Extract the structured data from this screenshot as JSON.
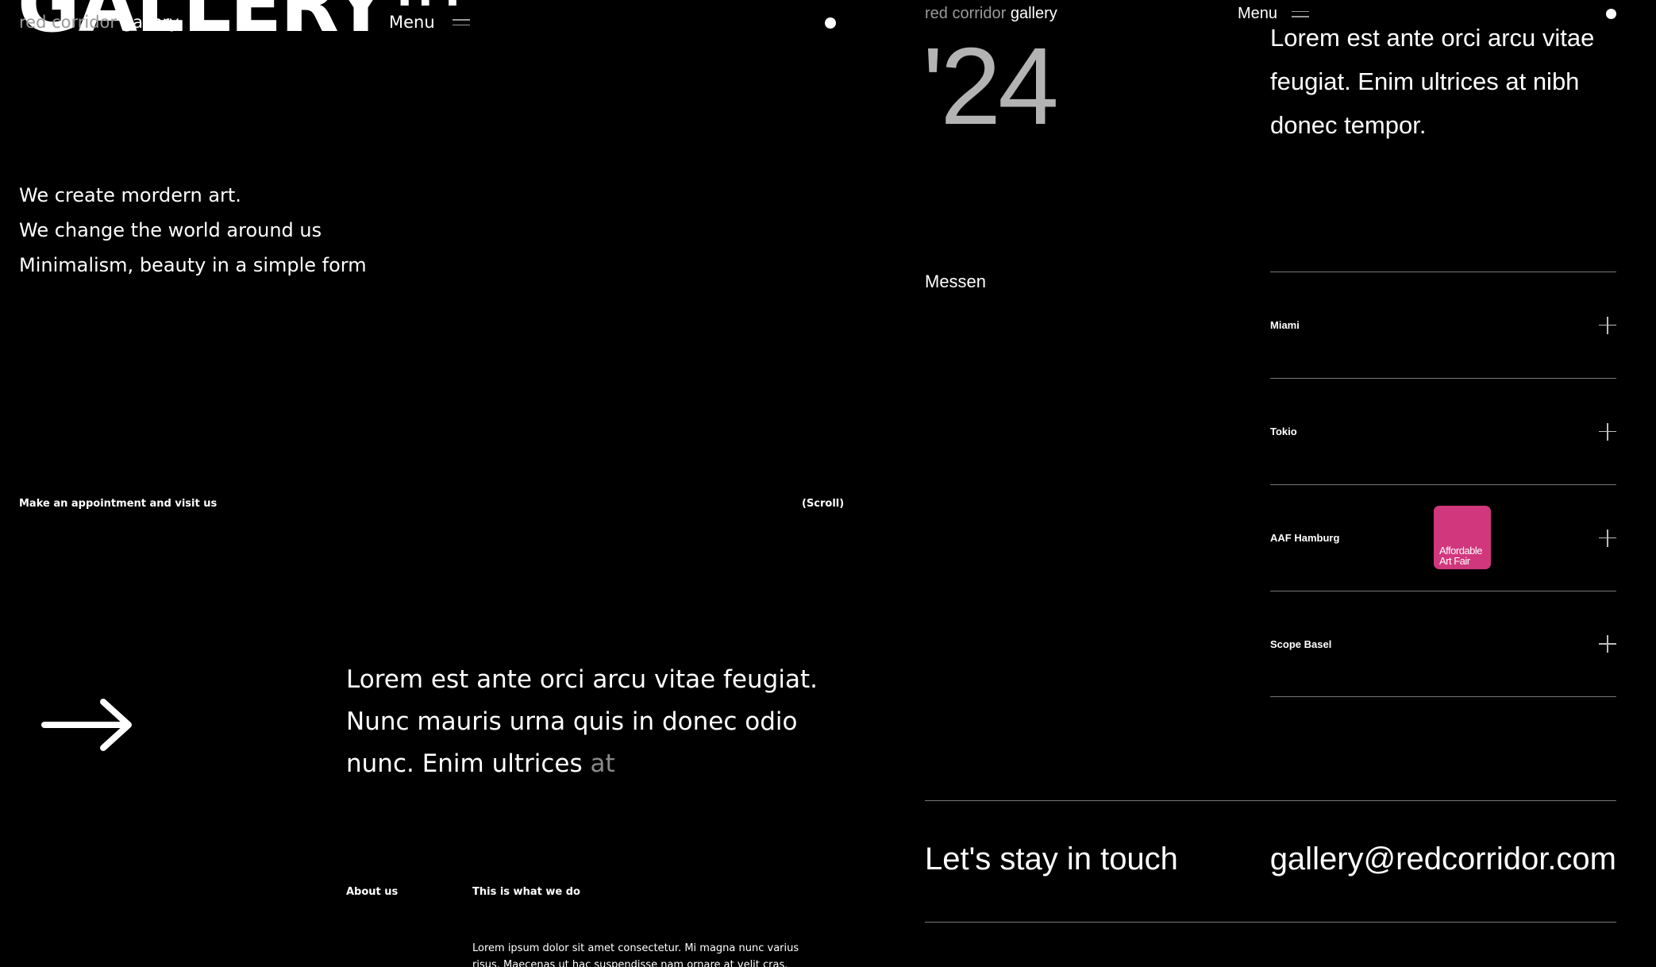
{
  "left": {
    "hero_title": "GALLERY",
    "hero_title_sup": "TM",
    "brand": {
      "muted": "red corridor",
      "main": "gallery"
    },
    "menu_label": "Menu",
    "intro_lines": [
      "We create mordern art.",
      "We change the world around us",
      "Minimalism, beauty in a simple form"
    ],
    "appointment": "Make an appointment and visit us",
    "scroll": "(Scroll)",
    "big_text_main": "Lorem est ante orci arcu vitae feugiat. Nunc mauris urna quis in donec odio nunc. Enim ultrices",
    "big_text_dim": "at",
    "about_label": "About us",
    "what_label": "This is what we do",
    "small_body": "Lorem ipsum dolor sit amet consectetur. Mi magna nunc varius risus. Maecenas ut hac suspendisse nam ornare at velit cras. Volutpat cursus."
  },
  "right": {
    "brand": {
      "muted": "red corridor",
      "main": "gallery"
    },
    "menu_label": "Menu",
    "year": "'24",
    "lorem": "Lorem est ante orci arcu vitae feugiat. Enim ultrices at nibh donec tempor.",
    "messen": "Messen",
    "fairs": [
      {
        "name": "Miami"
      },
      {
        "name": "Tokio"
      },
      {
        "name": "AAF Hamburg",
        "logo_text": [
          "Affordable",
          "Art Fair"
        ]
      },
      {
        "name": "Scope Basel"
      }
    ],
    "touch_label": "Let's stay in touch",
    "email": "gallery@redcorridor.com"
  },
  "colors": {
    "background": "#000000",
    "text": "#ffffff",
    "muted": "#9a9a9a",
    "year": "#b3b3b3",
    "aaf_logo": "#d1377c"
  }
}
